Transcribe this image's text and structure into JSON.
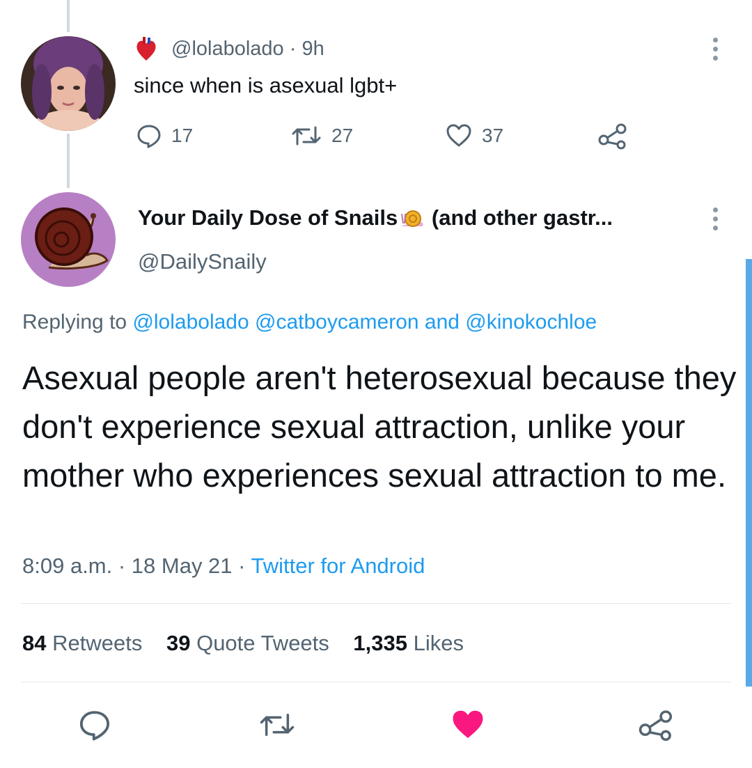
{
  "parent_tweet": {
    "handle": "@lolabolado",
    "time": "9h",
    "text": "since when is asexual lgbt+",
    "stats": {
      "replies": "17",
      "retweets": "27",
      "likes": "37"
    }
  },
  "main_tweet": {
    "display_name": "Your Daily Dose of Snails",
    "display_name_suffix": "(and other gastr...",
    "handle": "@DailySnaily",
    "replying_prefix": "Replying to",
    "replying_to": "@lolabolado @catboycameron and @kinokochloe",
    "text": "Asexual people aren't heterosexual because they don't experience sexual attraction, unlike your mother who experiences sexual attraction to me.",
    "timestamp": "8:09 a.m. · 18 May 21 · ",
    "source": "Twitter for Android",
    "engagement": {
      "retweets_count": "84",
      "retweets_label": "Retweets",
      "quotes_count": "39",
      "quotes_label": "Quote Tweets",
      "likes_count": "1,335",
      "likes_label": "Likes"
    }
  },
  "colors": {
    "accent": "#1d9bf0",
    "like": "#f91880",
    "muted": "#536471"
  }
}
